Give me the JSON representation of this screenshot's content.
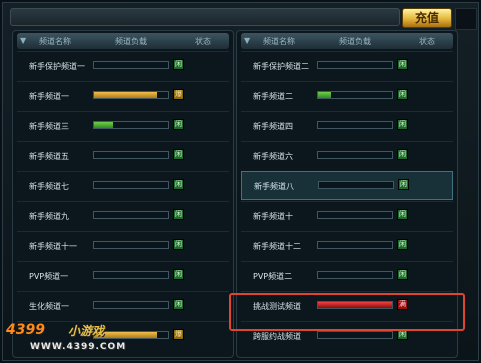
{
  "toolbar": {
    "recharge_label": "充值"
  },
  "headers": {
    "name": "频道名称",
    "count": "频道负载",
    "state": "状态"
  },
  "left_channels": [
    {
      "name": "新手保护频道一",
      "load": 0.0,
      "state": "闲",
      "level": "open"
    },
    {
      "name": "新手频道一",
      "load": 0.85,
      "state": "爆",
      "level": "full"
    },
    {
      "name": "新手频道三",
      "load": 0.25,
      "state": "闲",
      "level": "open"
    },
    {
      "name": "新手频道五",
      "load": 0.0,
      "state": "闲",
      "level": "open"
    },
    {
      "name": "新手频道七",
      "load": 0.0,
      "state": "闲",
      "level": "open"
    },
    {
      "name": "新手频道九",
      "load": 0.0,
      "state": "闲",
      "level": "open"
    },
    {
      "name": "新手频道十一",
      "load": 0.0,
      "state": "闲",
      "level": "open"
    },
    {
      "name": "PVP频道一",
      "load": 0.0,
      "state": "闲",
      "level": "open"
    },
    {
      "name": "生化频道一",
      "load": 0.0,
      "state": "闲",
      "level": "open"
    },
    {
      "name": "",
      "load": 0.85,
      "state": "爆",
      "level": "full"
    }
  ],
  "right_channels": [
    {
      "name": "新手保护频道二",
      "load": 0.0,
      "state": "闲",
      "level": "open"
    },
    {
      "name": "新手频道二",
      "load": 0.18,
      "state": "闲",
      "level": "open"
    },
    {
      "name": "新手频道四",
      "load": 0.0,
      "state": "闲",
      "level": "open"
    },
    {
      "name": "新手频道六",
      "load": 0.0,
      "state": "闲",
      "level": "open"
    },
    {
      "name": "新手频道八",
      "load": 0.0,
      "state": "闲",
      "level": "open"
    },
    {
      "name": "新手频道十",
      "load": 0.0,
      "state": "闲",
      "level": "open"
    },
    {
      "name": "新手频道十二",
      "load": 0.0,
      "state": "闲",
      "level": "open"
    },
    {
      "name": "PVP频道二",
      "load": 0.0,
      "state": "闲",
      "level": "open"
    },
    {
      "name": "挑战测试频道",
      "load": 1.0,
      "state": "满",
      "level": "busy"
    },
    {
      "name": "跨服约战频道",
      "load": 0.0,
      "state": "闲",
      "level": "open"
    }
  ],
  "selected_channel": "新手频道八",
  "watermark": {
    "logo": "4399",
    "subtitle": "小游戏",
    "url": "WWW.4399.COM"
  }
}
